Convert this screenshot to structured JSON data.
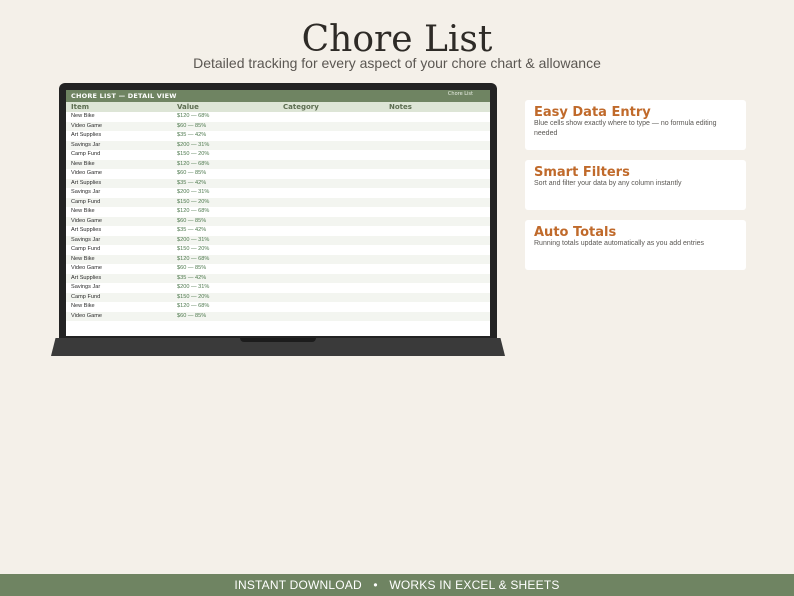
{
  "hero": {
    "title": "Chore List",
    "subtitle": "Detailed tracking for every aspect of your chore chart & allowance"
  },
  "sheet": {
    "header_title": "CHORE LIST — DETAIL VIEW",
    "header_right": "Chore List",
    "columns": [
      "Item",
      "Value",
      "Category",
      "Notes"
    ],
    "rows": [
      [
        "New Bike",
        "$120 — 68%"
      ],
      [
        "Video Game",
        "$60 — 85%"
      ],
      [
        "Art Supplies",
        "$35 — 42%"
      ],
      [
        "Savings Jar",
        "$200 — 31%"
      ],
      [
        "Camp Fund",
        "$150 — 20%"
      ],
      [
        "New Bike",
        "$120 — 68%"
      ],
      [
        "Video Game",
        "$60 — 85%"
      ],
      [
        "Art Supplies",
        "$35 — 42%"
      ],
      [
        "Savings Jar",
        "$200 — 31%"
      ],
      [
        "Camp Fund",
        "$150 — 20%"
      ],
      [
        "New Bike",
        "$120 — 68%"
      ],
      [
        "Video Game",
        "$60 — 85%"
      ],
      [
        "Art Supplies",
        "$35 — 42%"
      ],
      [
        "Savings Jar",
        "$200 — 31%"
      ],
      [
        "Camp Fund",
        "$150 — 20%"
      ],
      [
        "New Bike",
        "$120 — 68%"
      ],
      [
        "Video Game",
        "$60 — 85%"
      ],
      [
        "Art Supplies",
        "$35 — 42%"
      ],
      [
        "Savings Jar",
        "$200 — 31%"
      ],
      [
        "Camp Fund",
        "$150 — 20%"
      ],
      [
        "New Bike",
        "$120 — 68%"
      ],
      [
        "Video Game",
        "$60 — 85%"
      ]
    ]
  },
  "features": [
    {
      "title": "Easy Data Entry",
      "desc": "Blue cells show exactly where to type — no formula editing needed"
    },
    {
      "title": "Smart Filters",
      "desc": "Sort and filter your data by any column instantly"
    },
    {
      "title": "Auto Totals",
      "desc": "Running totals update automatically as you add entries"
    }
  ],
  "footer": {
    "left": "INSTANT DOWNLOAD",
    "separator": "•",
    "right": "WORKS IN EXCEL & SHEETS"
  },
  "colors": {
    "accent_green": "#6f8462",
    "feature_title": "#c06a2b",
    "background": "#f4f0e9"
  }
}
